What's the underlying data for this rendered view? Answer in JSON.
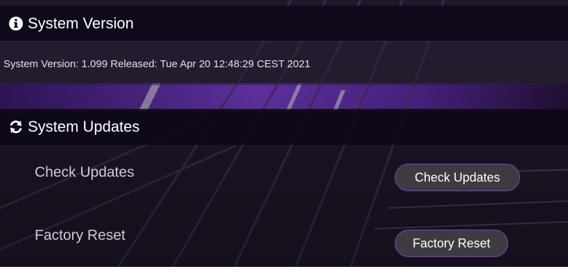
{
  "sections": {
    "version": {
      "title": "System Version",
      "icon": "info-circle-icon",
      "text": "System Version: 1.099 Released: Tue Apr 20 12:48:29 CEST 2021"
    },
    "updates": {
      "title": "System Updates",
      "icon": "refresh-icon",
      "rows": {
        "check": {
          "label": "Check Updates",
          "button": "Check Updates"
        },
        "reset": {
          "label": "Factory Reset",
          "button": "Factory Reset"
        }
      }
    }
  },
  "colors": {
    "header_bg": "#0c0616",
    "button_bg": "#3d3a40",
    "button_border": "#5b3b8a",
    "accent_purple": "#6a3fb0"
  }
}
